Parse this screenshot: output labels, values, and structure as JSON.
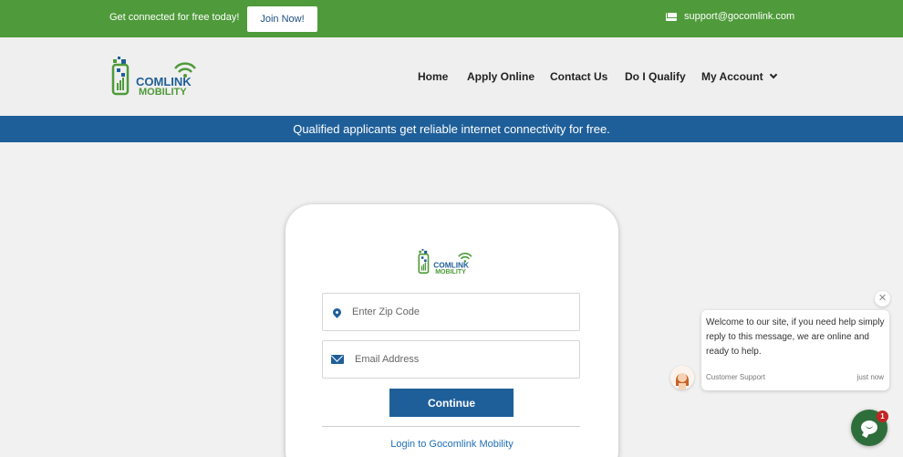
{
  "topbar": {
    "promo_text": "Get connected for free today!",
    "join_label": "Join Now!",
    "support_email": "support@gocomlink.com"
  },
  "header": {
    "logo": {
      "line1": "COMLINK",
      "line2": "MOBILITY"
    },
    "nav": {
      "home": "Home",
      "apply": "Apply Online",
      "contact": "Contact Us",
      "qualify": "Do I Qualify",
      "account": "My Account"
    }
  },
  "banner": {
    "text": "Qualified applicants get reliable internet connectivity for free."
  },
  "form": {
    "logo": {
      "line1": "COMLINK",
      "line2": "MOBILITY"
    },
    "zip_placeholder": "Enter Zip Code",
    "email_placeholder": "Email Address",
    "continue_label": "Continue",
    "login_link": "Login to Gocomlink Mobility"
  },
  "chat": {
    "message": "Welcome to our site, if you need help simply reply to this message, we are online and ready to help.",
    "agent": "Customer Support",
    "time": "just now",
    "unread_count": "1"
  },
  "colors": {
    "brand_green": "#4f9a3a",
    "brand_blue": "#1f5f99",
    "chat_green": "#2e6e3a"
  }
}
